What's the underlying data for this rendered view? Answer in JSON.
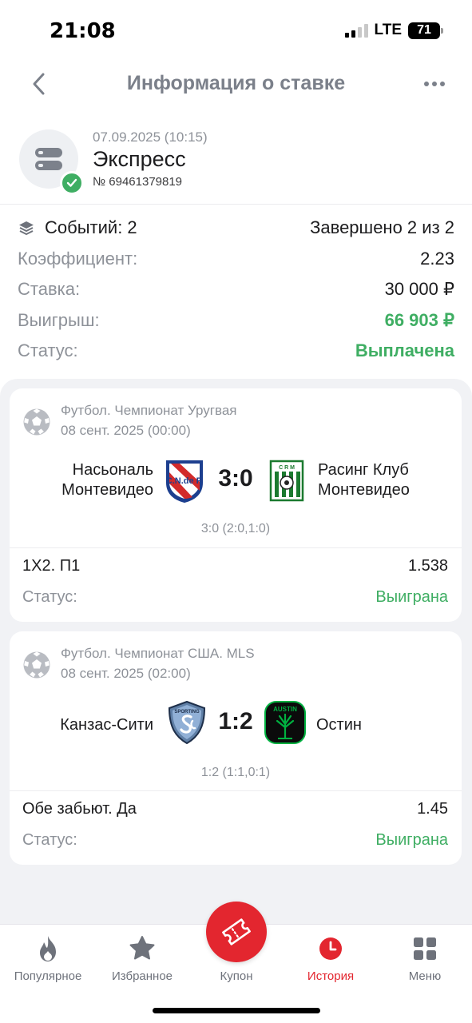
{
  "status_bar": {
    "time": "21:08",
    "network": "LTE",
    "battery": "71"
  },
  "nav": {
    "title": "Информация о ставке",
    "back_icon": "chevron-left-icon",
    "more_icon": "more-dots-icon"
  },
  "bet": {
    "date": "07.09.2025 (10:15)",
    "type": "Экспресс",
    "number": "№ 69461379819"
  },
  "summary": {
    "events_label": "Событий: 2",
    "completed": "Завершено 2 из 2",
    "rows": [
      {
        "label": "Коэффициент:",
        "value": "2.23"
      },
      {
        "label": "Ставка:",
        "value": "30 000 ₽"
      },
      {
        "label": "Выигрыш:",
        "value": "66 903 ₽"
      },
      {
        "label": "Статус:",
        "value": "Выплачена"
      }
    ]
  },
  "events": [
    {
      "league": "Футбол. Чемпионат Уругвая",
      "date": "08 сент. 2025 (00:00)",
      "home": "Насьональ\nМонтевидео",
      "away": "Расинг Клуб\nМонтевидео",
      "score": "3:0",
      "sub_score": "3:0 (2:0,1:0)",
      "market": "1X2. П1",
      "odds": "1.538",
      "status_label": "Статус:",
      "status": "Выиграна",
      "home_logo_text": "C.N.de F.",
      "away_logo_text": "C R M"
    },
    {
      "league": "Футбол. Чемпионат США. MLS",
      "date": "08 сент. 2025 (02:00)",
      "home": "Канзас-Сити",
      "away": "Остин",
      "score": "1:2",
      "sub_score": "1:2 (1:1,0:1)",
      "market": "Обе забьют. Да",
      "odds": "1.45",
      "status_label": "Статус:",
      "status": "Выиграна",
      "home_logo_text": "SPORTING",
      "away_logo_text": "AUSTIN"
    }
  ],
  "tabbar": {
    "items": [
      {
        "label": "Популярное",
        "icon": "flame-icon"
      },
      {
        "label": "Избранное",
        "icon": "star-icon"
      },
      {
        "label": "Купон",
        "icon": "ticket-icon"
      },
      {
        "label": "История",
        "icon": "clock-icon"
      },
      {
        "label": "Меню",
        "icon": "grid-icon"
      }
    ]
  },
  "colors": {
    "green": "#3fae63",
    "accent_red": "#e3262f",
    "muted": "#8e9299"
  }
}
